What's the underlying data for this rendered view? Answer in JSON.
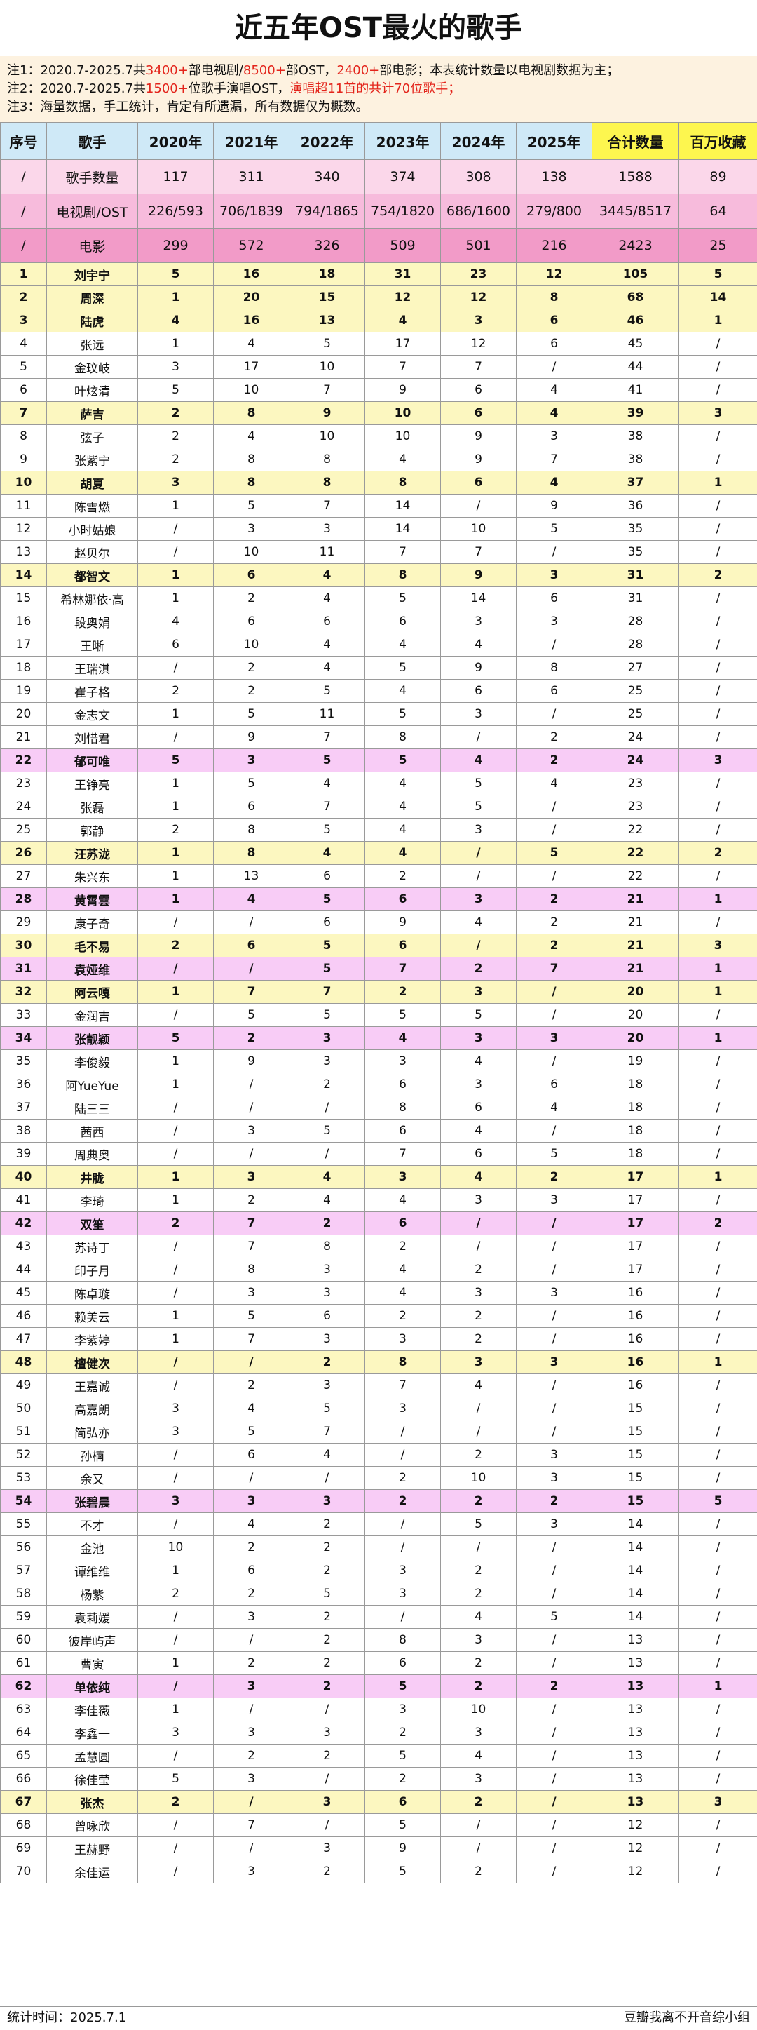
{
  "title": "近五年OST最火的歌手",
  "notes": [
    [
      {
        "t": "注1：2020.7-2025.7共"
      },
      {
        "t": "3400+",
        "r": 1
      },
      {
        "t": "部电视剧/"
      },
      {
        "t": "8500+",
        "r": 1
      },
      {
        "t": "部OST，"
      },
      {
        "t": "2400+",
        "r": 1
      },
      {
        "t": "部电影；本表统计数量以电视剧数据为主；"
      }
    ],
    [
      {
        "t": "注2：2020.7-2025.7共"
      },
      {
        "t": "1500+",
        "r": 1
      },
      {
        "t": "位歌手演唱OST，"
      },
      {
        "t": "演唱超11首的共计70位歌手；",
        "r": 1
      }
    ],
    [
      {
        "t": "注3：海量数据，手工统计，肯定有所遗漏，所有数据仅为概数。"
      }
    ]
  ],
  "headers": [
    "序号",
    "歌手",
    "2020年",
    "2021年",
    "2022年",
    "2023年",
    "2024年",
    "2025年",
    "合计数量",
    "百万收藏"
  ],
  "summary_rows": [
    [
      "/",
      "歌手数量",
      "117",
      "311",
      "340",
      "374",
      "308",
      "138",
      "1588",
      "89"
    ],
    [
      "/",
      "电视剧/OST",
      "226/593",
      "706/1839",
      "794/1865",
      "754/1820",
      "686/1600",
      "279/800",
      "3445/8517",
      "64"
    ],
    [
      "/",
      "电影",
      "299",
      "572",
      "326",
      "509",
      "501",
      "216",
      "2423",
      "25"
    ]
  ],
  "rows": [
    {
      "h": "y",
      "c": [
        "1",
        "刘宇宁",
        "5",
        "16",
        "18",
        "31",
        "23",
        "12",
        "105",
        "5"
      ]
    },
    {
      "h": "y",
      "c": [
        "2",
        "周深",
        "1",
        "20",
        "15",
        "12",
        "12",
        "8",
        "68",
        "14"
      ]
    },
    {
      "h": "y",
      "c": [
        "3",
        "陆虎",
        "4",
        "16",
        "13",
        "4",
        "3",
        "6",
        "46",
        "1"
      ]
    },
    {
      "h": "",
      "c": [
        "4",
        "张远",
        "1",
        "4",
        "5",
        "17",
        "12",
        "6",
        "45",
        "/"
      ]
    },
    {
      "h": "",
      "c": [
        "5",
        "金玟岐",
        "3",
        "17",
        "10",
        "7",
        "7",
        "/",
        "44",
        "/"
      ]
    },
    {
      "h": "",
      "c": [
        "6",
        "叶炫清",
        "5",
        "10",
        "7",
        "9",
        "6",
        "4",
        "41",
        "/"
      ]
    },
    {
      "h": "y",
      "c": [
        "7",
        "萨吉",
        "2",
        "8",
        "9",
        "10",
        "6",
        "4",
        "39",
        "3"
      ]
    },
    {
      "h": "",
      "c": [
        "8",
        "弦子",
        "2",
        "4",
        "10",
        "10",
        "9",
        "3",
        "38",
        "/"
      ]
    },
    {
      "h": "",
      "c": [
        "9",
        "张紫宁",
        "2",
        "8",
        "8",
        "4",
        "9",
        "7",
        "38",
        "/"
      ]
    },
    {
      "h": "y",
      "c": [
        "10",
        "胡夏",
        "3",
        "8",
        "8",
        "8",
        "6",
        "4",
        "37",
        "1"
      ]
    },
    {
      "h": "",
      "c": [
        "11",
        "陈雪燃",
        "1",
        "5",
        "7",
        "14",
        "/",
        "9",
        "36",
        "/"
      ]
    },
    {
      "h": "",
      "c": [
        "12",
        "小时姑娘",
        "/",
        "3",
        "3",
        "14",
        "10",
        "5",
        "35",
        "/"
      ]
    },
    {
      "h": "",
      "c": [
        "13",
        "赵贝尔",
        "/",
        "10",
        "11",
        "7",
        "7",
        "/",
        "35",
        "/"
      ]
    },
    {
      "h": "y",
      "c": [
        "14",
        "都智文",
        "1",
        "6",
        "4",
        "8",
        "9",
        "3",
        "31",
        "2"
      ]
    },
    {
      "h": "",
      "c": [
        "15",
        "希林娜依·高",
        "1",
        "2",
        "4",
        "5",
        "14",
        "6",
        "31",
        "/"
      ]
    },
    {
      "h": "",
      "c": [
        "16",
        "段奥娟",
        "4",
        "6",
        "6",
        "6",
        "3",
        "3",
        "28",
        "/"
      ]
    },
    {
      "h": "",
      "c": [
        "17",
        "王晰",
        "6",
        "10",
        "4",
        "4",
        "4",
        "/",
        "28",
        "/"
      ]
    },
    {
      "h": "",
      "c": [
        "18",
        "王瑞淇",
        "/",
        "2",
        "4",
        "5",
        "9",
        "8",
        "27",
        "/"
      ]
    },
    {
      "h": "",
      "c": [
        "19",
        "崔子格",
        "2",
        "2",
        "5",
        "4",
        "6",
        "6",
        "25",
        "/"
      ]
    },
    {
      "h": "",
      "c": [
        "20",
        "金志文",
        "1",
        "5",
        "11",
        "5",
        "3",
        "/",
        "25",
        "/"
      ]
    },
    {
      "h": "",
      "c": [
        "21",
        "刘惜君",
        "/",
        "9",
        "7",
        "8",
        "/",
        "2",
        "24",
        "/"
      ]
    },
    {
      "h": "p",
      "c": [
        "22",
        "郁可唯",
        "5",
        "3",
        "5",
        "5",
        "4",
        "2",
        "24",
        "3"
      ]
    },
    {
      "h": "",
      "c": [
        "23",
        "王铮亮",
        "1",
        "5",
        "4",
        "4",
        "5",
        "4",
        "23",
        "/"
      ]
    },
    {
      "h": "",
      "c": [
        "24",
        "张磊",
        "1",
        "6",
        "7",
        "4",
        "5",
        "/",
        "23",
        "/"
      ]
    },
    {
      "h": "",
      "c": [
        "25",
        "郭静",
        "2",
        "8",
        "5",
        "4",
        "3",
        "/",
        "22",
        "/"
      ]
    },
    {
      "h": "y",
      "c": [
        "26",
        "汪苏泷",
        "1",
        "8",
        "4",
        "4",
        "/",
        "5",
        "22",
        "2"
      ]
    },
    {
      "h": "",
      "c": [
        "27",
        "朱兴东",
        "1",
        "13",
        "6",
        "2",
        "/",
        "/",
        "22",
        "/"
      ]
    },
    {
      "h": "p",
      "c": [
        "28",
        "黄霄雲",
        "1",
        "4",
        "5",
        "6",
        "3",
        "2",
        "21",
        "1"
      ]
    },
    {
      "h": "",
      "c": [
        "29",
        "康子奇",
        "/",
        "/",
        "6",
        "9",
        "4",
        "2",
        "21",
        "/"
      ]
    },
    {
      "h": "y",
      "c": [
        "30",
        "毛不易",
        "2",
        "6",
        "5",
        "6",
        "/",
        "2",
        "21",
        "3"
      ]
    },
    {
      "h": "p",
      "c": [
        "31",
        "袁娅维",
        "/",
        "/",
        "5",
        "7",
        "2",
        "7",
        "21",
        "1"
      ]
    },
    {
      "h": "y",
      "c": [
        "32",
        "阿云嘎",
        "1",
        "7",
        "7",
        "2",
        "3",
        "/",
        "20",
        "1"
      ]
    },
    {
      "h": "",
      "c": [
        "33",
        "金润吉",
        "/",
        "5",
        "5",
        "5",
        "5",
        "/",
        "20",
        "/"
      ]
    },
    {
      "h": "p",
      "c": [
        "34",
        "张靓颖",
        "5",
        "2",
        "3",
        "4",
        "3",
        "3",
        "20",
        "1"
      ]
    },
    {
      "h": "",
      "c": [
        "35",
        "李俊毅",
        "1",
        "9",
        "3",
        "3",
        "4",
        "/",
        "19",
        "/"
      ]
    },
    {
      "h": "",
      "c": [
        "36",
        "阿YueYue",
        "1",
        "/",
        "2",
        "6",
        "3",
        "6",
        "18",
        "/"
      ]
    },
    {
      "h": "",
      "c": [
        "37",
        "陆三三",
        "/",
        "/",
        "/",
        "8",
        "6",
        "4",
        "18",
        "/"
      ]
    },
    {
      "h": "",
      "c": [
        "38",
        "茜西",
        "/",
        "3",
        "5",
        "6",
        "4",
        "/",
        "18",
        "/"
      ]
    },
    {
      "h": "",
      "c": [
        "39",
        "周典奥",
        "/",
        "/",
        "/",
        "7",
        "6",
        "5",
        "18",
        "/"
      ]
    },
    {
      "h": "y",
      "c": [
        "40",
        "井胧",
        "1",
        "3",
        "4",
        "3",
        "4",
        "2",
        "17",
        "1"
      ]
    },
    {
      "h": "",
      "c": [
        "41",
        "李琦",
        "1",
        "2",
        "4",
        "4",
        "3",
        "3",
        "17",
        "/"
      ]
    },
    {
      "h": "p",
      "c": [
        "42",
        "双笙",
        "2",
        "7",
        "2",
        "6",
        "/",
        "/",
        "17",
        "2"
      ]
    },
    {
      "h": "",
      "c": [
        "43",
        "苏诗丁",
        "/",
        "7",
        "8",
        "2",
        "/",
        "/",
        "17",
        "/"
      ]
    },
    {
      "h": "",
      "c": [
        "44",
        "印子月",
        "/",
        "8",
        "3",
        "4",
        "2",
        "/",
        "17",
        "/"
      ]
    },
    {
      "h": "",
      "c": [
        "45",
        "陈卓璇",
        "/",
        "3",
        "3",
        "4",
        "3",
        "3",
        "16",
        "/"
      ]
    },
    {
      "h": "",
      "c": [
        "46",
        "赖美云",
        "1",
        "5",
        "6",
        "2",
        "2",
        "/",
        "16",
        "/"
      ]
    },
    {
      "h": "",
      "c": [
        "47",
        "李紫婷",
        "1",
        "7",
        "3",
        "3",
        "2",
        "/",
        "16",
        "/"
      ]
    },
    {
      "h": "y",
      "c": [
        "48",
        "檀健次",
        "/",
        "/",
        "2",
        "8",
        "3",
        "3",
        "16",
        "1"
      ]
    },
    {
      "h": "",
      "c": [
        "49",
        "王嘉诚",
        "/",
        "2",
        "3",
        "7",
        "4",
        "/",
        "16",
        "/"
      ]
    },
    {
      "h": "",
      "c": [
        "50",
        "高嘉朗",
        "3",
        "4",
        "5",
        "3",
        "/",
        "/",
        "15",
        "/"
      ]
    },
    {
      "h": "",
      "c": [
        "51",
        "简弘亦",
        "3",
        "5",
        "7",
        "/",
        "/",
        "/",
        "15",
        "/"
      ]
    },
    {
      "h": "",
      "c": [
        "52",
        "孙楠",
        "/",
        "6",
        "4",
        "/",
        "2",
        "3",
        "15",
        "/"
      ]
    },
    {
      "h": "",
      "c": [
        "53",
        "余又",
        "/",
        "/",
        "/",
        "2",
        "10",
        "3",
        "15",
        "/"
      ]
    },
    {
      "h": "p",
      "c": [
        "54",
        "张碧晨",
        "3",
        "3",
        "3",
        "2",
        "2",
        "2",
        "15",
        "5"
      ]
    },
    {
      "h": "",
      "c": [
        "55",
        "不才",
        "/",
        "4",
        "2",
        "/",
        "5",
        "3",
        "14",
        "/"
      ]
    },
    {
      "h": "",
      "c": [
        "56",
        "金池",
        "10",
        "2",
        "2",
        "/",
        "/",
        "/",
        "14",
        "/"
      ]
    },
    {
      "h": "",
      "c": [
        "57",
        "谭维维",
        "1",
        "6",
        "2",
        "3",
        "2",
        "/",
        "14",
        "/"
      ]
    },
    {
      "h": "",
      "c": [
        "58",
        "杨紫",
        "2",
        "2",
        "5",
        "3",
        "2",
        "/",
        "14",
        "/"
      ]
    },
    {
      "h": "",
      "c": [
        "59",
        "袁莉媛",
        "/",
        "3",
        "2",
        "/",
        "4",
        "5",
        "14",
        "/"
      ]
    },
    {
      "h": "",
      "c": [
        "60",
        "彼岸屿声",
        "/",
        "/",
        "2",
        "8",
        "3",
        "/",
        "13",
        "/"
      ]
    },
    {
      "h": "",
      "c": [
        "61",
        "曹寅",
        "1",
        "2",
        "2",
        "6",
        "2",
        "/",
        "13",
        "/"
      ]
    },
    {
      "h": "p",
      "c": [
        "62",
        "单依纯",
        "/",
        "3",
        "2",
        "5",
        "2",
        "2",
        "13",
        "1"
      ]
    },
    {
      "h": "",
      "c": [
        "63",
        "李佳薇",
        "1",
        "/",
        "/",
        "3",
        "10",
        "/",
        "13",
        "/"
      ]
    },
    {
      "h": "",
      "c": [
        "64",
        "李鑫一",
        "3",
        "3",
        "3",
        "2",
        "3",
        "/",
        "13",
        "/"
      ]
    },
    {
      "h": "",
      "c": [
        "65",
        "孟慧圆",
        "/",
        "2",
        "2",
        "5",
        "4",
        "/",
        "13",
        "/"
      ]
    },
    {
      "h": "",
      "c": [
        "66",
        "徐佳莹",
        "5",
        "3",
        "/",
        "2",
        "3",
        "/",
        "13",
        "/"
      ]
    },
    {
      "h": "y",
      "c": [
        "67",
        "张杰",
        "2",
        "/",
        "3",
        "6",
        "2",
        "/",
        "13",
        "3"
      ]
    },
    {
      "h": "",
      "c": [
        "68",
        "曾咏欣",
        "/",
        "7",
        "/",
        "5",
        "/",
        "/",
        "12",
        "/"
      ]
    },
    {
      "h": "",
      "c": [
        "69",
        "王赫野",
        "/",
        "/",
        "3",
        "9",
        "/",
        "/",
        "12",
        "/"
      ]
    },
    {
      "h": "",
      "c": [
        "70",
        "余佳运",
        "/",
        "3",
        "2",
        "5",
        "2",
        "/",
        "12",
        "/"
      ]
    }
  ],
  "footer": {
    "left": "统计时间：2025.7.1",
    "right": "豆瓣我离不开音综小组"
  }
}
